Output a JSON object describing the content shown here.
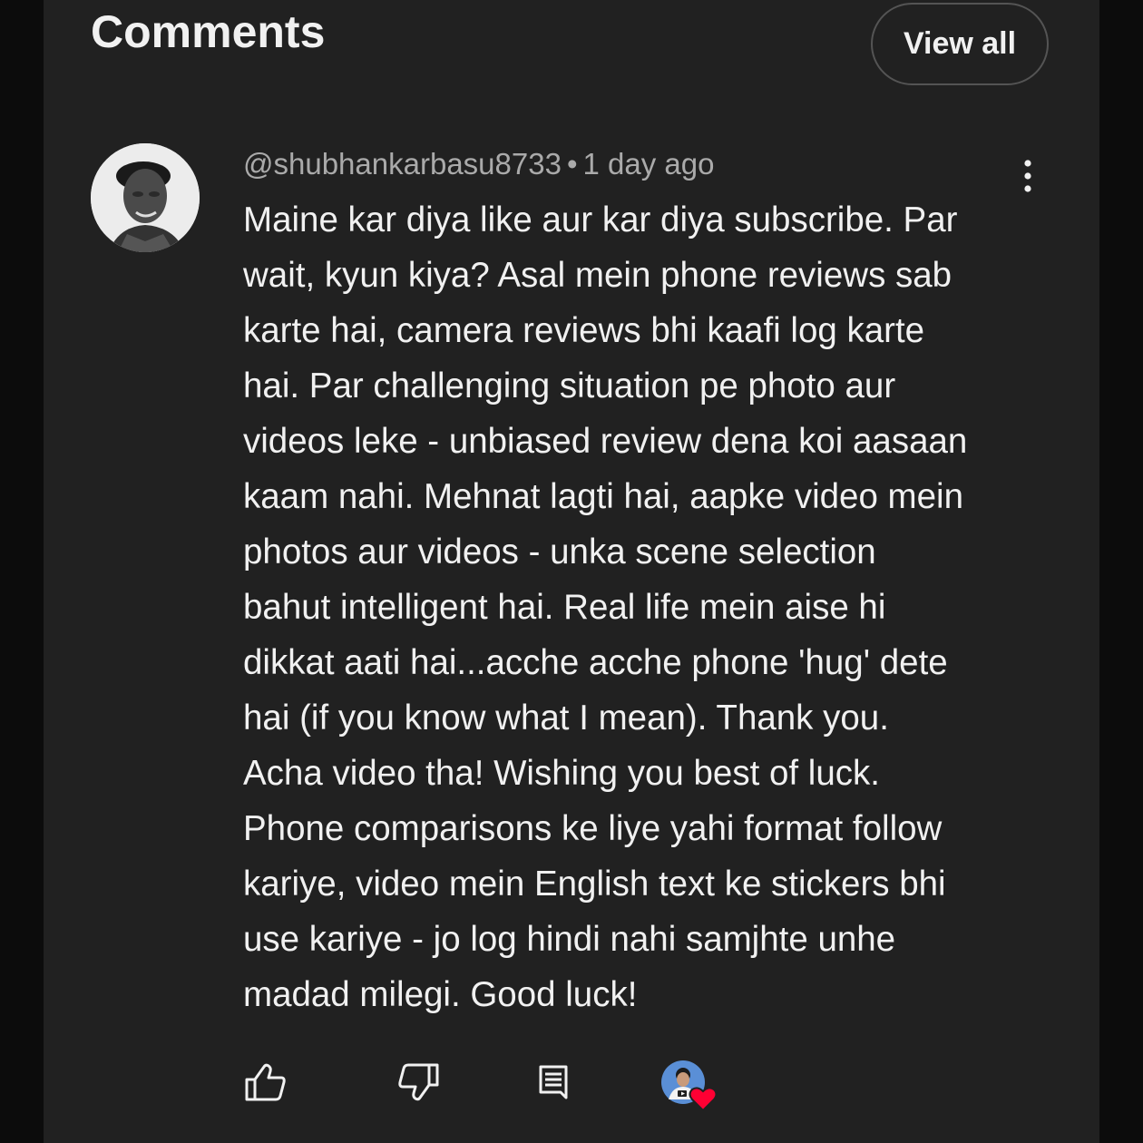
{
  "header": {
    "title": "Comments",
    "view_all_label": "View all"
  },
  "comment": {
    "author": "@shubhankarbasu8733",
    "separator": "•",
    "time": "1 day ago",
    "text_lines": [
      "Maine kar diya like aur kar diya subscribe. Par",
      "wait, kyun kiya? Asal mein phone reviews sab",
      "karte hai, camera reviews bhi kaafi log karte",
      "hai. Par challenging situation pe photo aur",
      "videos leke - unbiased review dena koi aasaan",
      "kaam nahi. Mehnat lagti hai, aapke video mein",
      "photos aur videos - unka scene selection",
      "bahut intelligent hai. Real life mein aise hi",
      "dikkat aati hai...acche acche phone 'hug' dete",
      "hai (if you know what I mean). Thank you.",
      "Acha video tha! Wishing you best of luck.",
      "Phone comparisons ke liye yahi format follow",
      "kariye, video mein English text ke stickers bhi",
      "use kariye - jo log hindi nahi samjhte unhe",
      "madad milegi. Good luck!"
    ]
  },
  "actions": {
    "icons": [
      "thumbs-up-icon",
      "thumbs-down-icon",
      "reply-icon",
      "creator-heart-icon"
    ]
  },
  "colors": {
    "background": "#212121",
    "outer": "#0c0c0c",
    "text": "#f1f1f1",
    "secondary_text": "#aaaaaa",
    "button_border": "#545454",
    "heart": "#ff0033"
  }
}
